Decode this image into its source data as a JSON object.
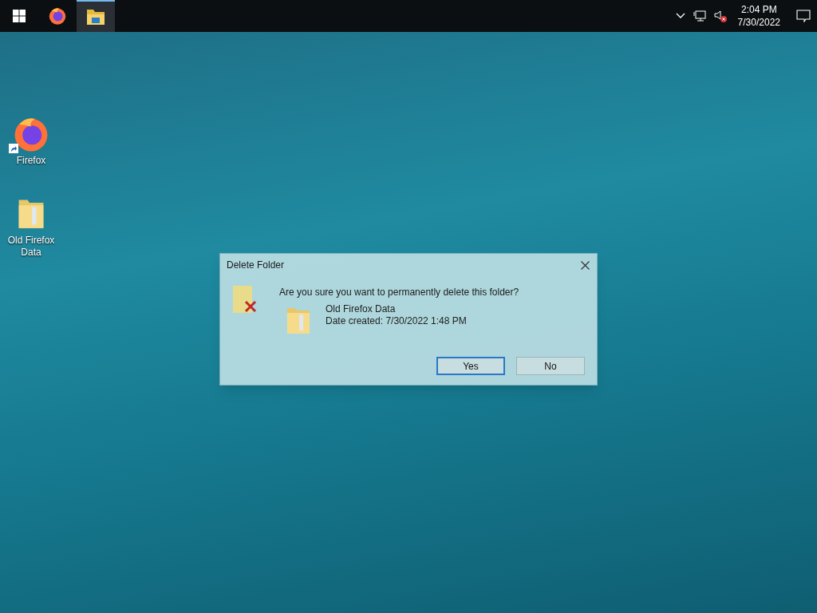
{
  "taskbar": {
    "items": [
      {
        "kind": "start",
        "selected": false
      },
      {
        "kind": "firefox",
        "selected": false
      },
      {
        "kind": "explorer",
        "selected": true
      }
    ],
    "tray": {
      "clock_time": "2:04 PM",
      "clock_date": "7/30/2022",
      "volume_muted": true
    }
  },
  "desktop_icons": [
    {
      "kind": "firefox",
      "label": "Firefox",
      "shortcut": true
    },
    {
      "kind": "folder",
      "label": "Old Firefox Data",
      "shortcut": false
    }
  ],
  "dialog": {
    "title": "Delete Folder",
    "message": "Are you sure you want to permanently delete this folder?",
    "item_name": "Old Firefox Data",
    "item_detail": "Date created: 7/30/2022 1:48 PM",
    "buttons": [
      {
        "label": "Yes",
        "default": true
      },
      {
        "label": "No",
        "default": false
      }
    ]
  }
}
